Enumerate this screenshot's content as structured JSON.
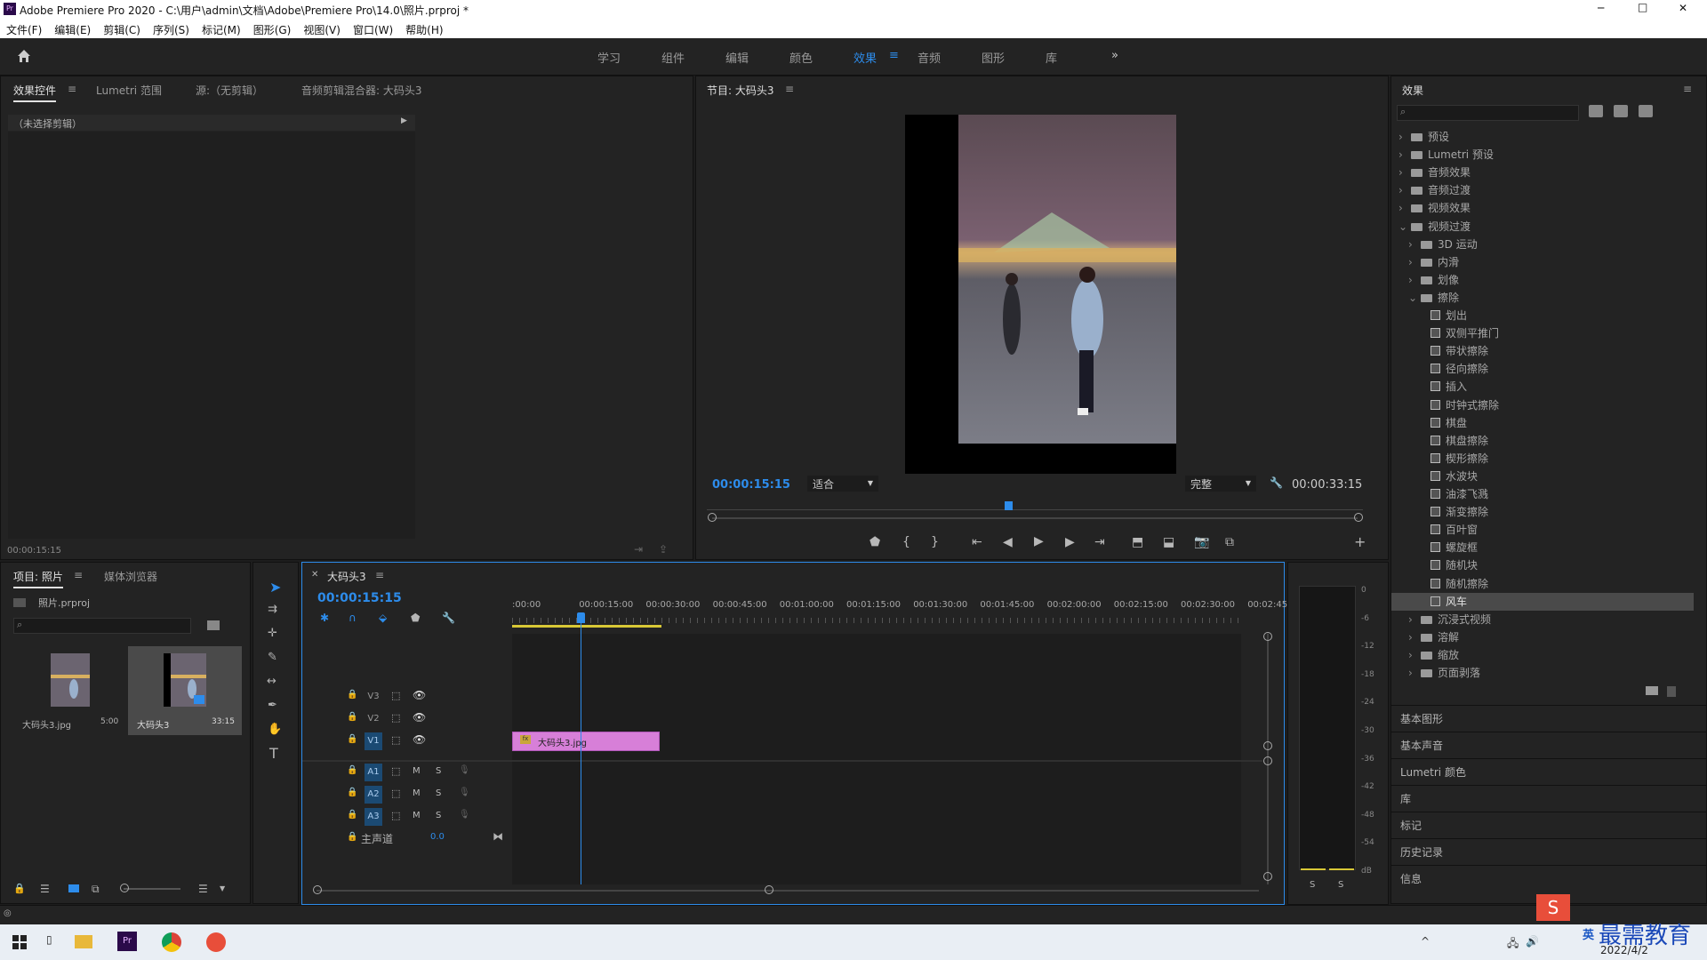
{
  "window": {
    "title": "Adobe Premiere Pro 2020 - C:\\用户\\admin\\文档\\Adobe\\Premiere Pro\\14.0\\照片.prproj *",
    "app_icon": "Pr",
    "min": "─",
    "max": "□",
    "close": "✕"
  },
  "menu": [
    "文件(F)",
    "编辑(E)",
    "剪辑(C)",
    "序列(S)",
    "标记(M)",
    "图形(G)",
    "视图(V)",
    "窗口(W)",
    "帮助(H)"
  ],
  "workspaces": {
    "home_icon": "home-icon",
    "tabs": [
      "学习",
      "组件",
      "编辑",
      "颜色",
      "效果",
      "音频",
      "图形",
      "库"
    ],
    "active": "效果",
    "more": "»"
  },
  "effect_controls": {
    "tabs": [
      "效果控件",
      "Lumetri 范围",
      "源:（无剪辑）",
      "音频剪辑混合器: 大码头3"
    ],
    "no_clip": "（未选择剪辑）",
    "timecode": "00:00:15:15"
  },
  "program": {
    "title": "节目: 大码头3",
    "timecode": "00:00:15:15",
    "fit": "适合",
    "quality": "完整",
    "duration": "00:00:33:15",
    "playhead_pct": 0.46
  },
  "effects_panel": {
    "title": "效果",
    "search_placeholder": "",
    "tree": [
      {
        "label": "预设",
        "level": 0,
        "type": "folder",
        "open": false
      },
      {
        "label": "Lumetri 预设",
        "level": 0,
        "type": "folder",
        "open": false
      },
      {
        "label": "音频效果",
        "level": 0,
        "type": "folder",
        "open": false
      },
      {
        "label": "音频过渡",
        "level": 0,
        "type": "folder",
        "open": false
      },
      {
        "label": "视频效果",
        "level": 0,
        "type": "folder",
        "open": false
      },
      {
        "label": "视频过渡",
        "level": 0,
        "type": "folder",
        "open": true
      },
      {
        "label": "3D 运动",
        "level": 1,
        "type": "folder",
        "open": false
      },
      {
        "label": "内滑",
        "level": 1,
        "type": "folder",
        "open": false
      },
      {
        "label": "划像",
        "level": 1,
        "type": "folder",
        "open": false
      },
      {
        "label": "擦除",
        "level": 1,
        "type": "folder",
        "open": true
      },
      {
        "label": "划出",
        "level": 2,
        "type": "fx"
      },
      {
        "label": "双侧平推门",
        "level": 2,
        "type": "fx"
      },
      {
        "label": "带状擦除",
        "level": 2,
        "type": "fx"
      },
      {
        "label": "径向擦除",
        "level": 2,
        "type": "fx"
      },
      {
        "label": "插入",
        "level": 2,
        "type": "fx"
      },
      {
        "label": "时钟式擦除",
        "level": 2,
        "type": "fx"
      },
      {
        "label": "棋盘",
        "level": 2,
        "type": "fx"
      },
      {
        "label": "棋盘擦除",
        "level": 2,
        "type": "fx"
      },
      {
        "label": "楔形擦除",
        "level": 2,
        "type": "fx"
      },
      {
        "label": "水波块",
        "level": 2,
        "type": "fx"
      },
      {
        "label": "油漆飞溅",
        "level": 2,
        "type": "fx"
      },
      {
        "label": "渐变擦除",
        "level": 2,
        "type": "fx"
      },
      {
        "label": "百叶窗",
        "level": 2,
        "type": "fx"
      },
      {
        "label": "螺旋框",
        "level": 2,
        "type": "fx"
      },
      {
        "label": "随机块",
        "level": 2,
        "type": "fx"
      },
      {
        "label": "随机擦除",
        "level": 2,
        "type": "fx"
      },
      {
        "label": "风车",
        "level": 2,
        "type": "fx",
        "selected": true
      },
      {
        "label": "沉浸式视频",
        "level": 1,
        "type": "folder",
        "open": false
      },
      {
        "label": "溶解",
        "level": 1,
        "type": "folder",
        "open": false
      },
      {
        "label": "缩放",
        "level": 1,
        "type": "folder",
        "open": false
      },
      {
        "label": "页面剥落",
        "level": 1,
        "type": "folder",
        "open": false
      }
    ],
    "sections": [
      "基本图形",
      "基本声音",
      "Lumetri 颜色",
      "库",
      "标记",
      "历史记录",
      "信息"
    ]
  },
  "project": {
    "tabs": [
      "项目: 照片",
      "媒体浏览器"
    ],
    "file": "照片.prproj",
    "items": [
      {
        "name": "大码头3.jpg",
        "duration": "5:00"
      },
      {
        "name": "大码头3",
        "duration": "33:15"
      }
    ]
  },
  "timeline": {
    "tab": "大码头3",
    "timecode": "00:00:15:15",
    "ruler": [
      ":00:00",
      "00:00:15:00",
      "00:00:30:00",
      "00:00:45:00",
      "00:01:00:00",
      "00:01:15:00",
      "00:01:30:00",
      "00:01:45:00",
      "00:02:00:00",
      "00:02:15:00",
      "00:02:30:00",
      "00:02:45:"
    ],
    "video_tracks": [
      "V3",
      "V2",
      "V1"
    ],
    "audio_tracks": [
      "A1",
      "A2",
      "A3"
    ],
    "master_label": "主声道",
    "master_value": "0.0",
    "clip_label": "大码头3.jpg",
    "m": "M",
    "s": "S"
  },
  "meter": {
    "scale": [
      "0",
      "-6",
      "-12",
      "-18",
      "-24",
      "-30",
      "-36",
      "-42",
      "-48",
      "-54",
      "dB"
    ],
    "solo": [
      "S",
      "S"
    ]
  },
  "taskbar": {
    "ime": "英",
    "date": "2022/4/2",
    "watermark": "最需教育"
  },
  "colors": {
    "accent": "#2d8ceb",
    "clip": "#d77fd8",
    "panel": "#232323"
  }
}
